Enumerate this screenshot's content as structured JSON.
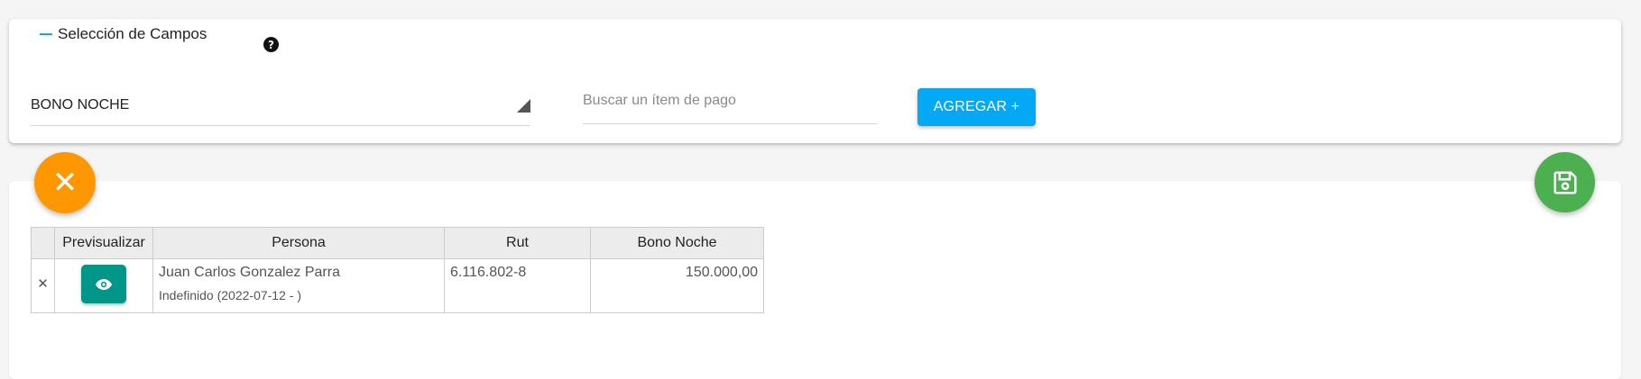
{
  "section": {
    "title": "Selección de Campos",
    "help_icon": "?"
  },
  "controls": {
    "select_value": "BONO NOCHE",
    "search_placeholder": "Buscar un ítem de pago",
    "search_value": "",
    "add_label": "AGREGAR +"
  },
  "fabs": {
    "close_symbol": "✕",
    "close_color": "#ff9800",
    "save_color": "#4caf50"
  },
  "table": {
    "headers": [
      "",
      "Previsualizar",
      "Persona",
      "Rut",
      "Bono Noche"
    ],
    "rows": [
      {
        "delete_symbol": "✕",
        "persona_name": "Juan Carlos Gonzalez Parra",
        "persona_contract": "Indefinido (2022-07-12 - )",
        "rut": "6.116.802-8",
        "bono_noche": "150.000,00"
      }
    ]
  },
  "colors": {
    "accent": "#03a9f4",
    "preview_button": "#009688",
    "collapse_icon": "#1aa7c8"
  }
}
